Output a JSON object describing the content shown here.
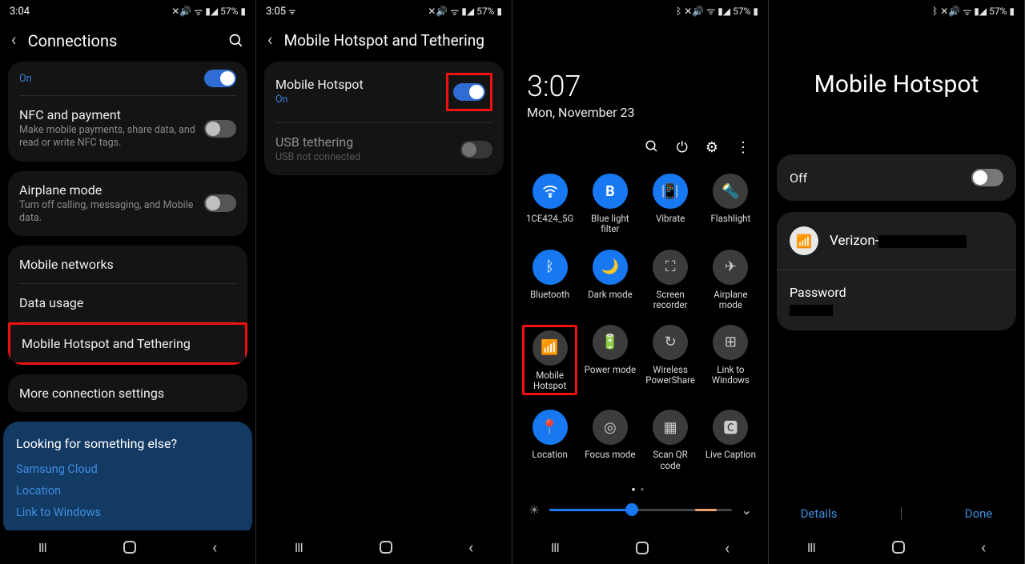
{
  "panel1": {
    "time": "3:04",
    "battery": "57%",
    "header": "Connections",
    "on_label": "On",
    "nfc_title": "NFC and payment",
    "nfc_sub": "Make mobile payments, share data, and read or write NFC tags.",
    "airplane_title": "Airplane mode",
    "airplane_sub": "Turn off calling, messaging, and Mobile data.",
    "mobile_networks": "Mobile networks",
    "data_usage": "Data usage",
    "hotspot": "Mobile Hotspot and Tethering",
    "more": "More connection settings",
    "looking": "Looking for something else?",
    "link1": "Samsung Cloud",
    "link2": "Location",
    "link3": "Link to Windows"
  },
  "panel2": {
    "time": "3:05",
    "battery": "57%",
    "header": "Mobile Hotspot and Tethering",
    "mh_title": "Mobile Hotspot",
    "mh_sub": "On",
    "usb_title": "USB tethering",
    "usb_sub": "USB not connected"
  },
  "panel3": {
    "battery": "57%",
    "time": "3:07",
    "date": "Mon, November 23",
    "tiles": {
      "t0": "1CE424_5G",
      "t1": "Blue light filter",
      "t2": "Vibrate",
      "t3": "Flashlight",
      "t4": "Bluetooth",
      "t5": "Dark mode",
      "t6": "Screen recorder",
      "t7": "Airplane mode",
      "t8": "Mobile Hotspot",
      "t9": "Power mode",
      "t10": "Wireless PowerShare",
      "t11": "Link to Windows",
      "t12": "Location",
      "t13": "Focus mode",
      "t14": "Scan QR code",
      "t15": "Live Caption"
    }
  },
  "panel4": {
    "battery": "57%",
    "title": "Mobile Hotspot",
    "off": "Off",
    "network_prefix": "Verizon-",
    "password_label": "Password",
    "details": "Details",
    "done": "Done"
  }
}
